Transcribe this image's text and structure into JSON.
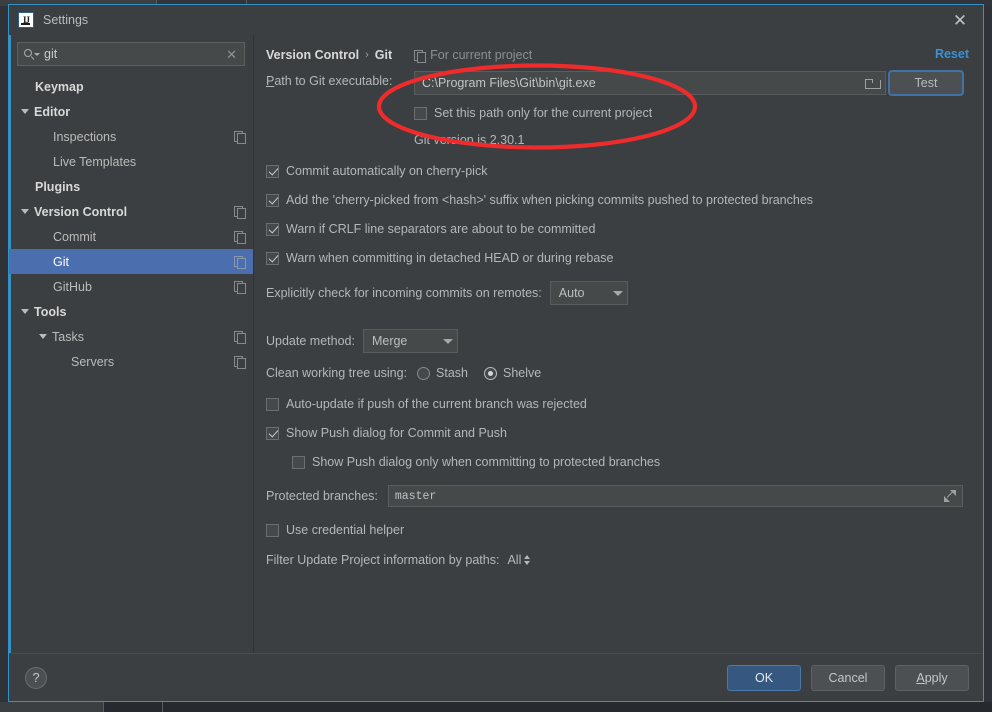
{
  "window": {
    "title": "Settings",
    "logo_icon": "intellij-idea-logo",
    "close_icon": "close-icon"
  },
  "sidebar": {
    "search": {
      "value": "git",
      "placeholder": "Search settings",
      "search_icon": "search-icon",
      "clear_icon": "close-icon"
    },
    "items": [
      {
        "label": "Keymap",
        "depth": 0,
        "arrow": false,
        "bold": true,
        "selected": false,
        "copy_icon": false
      },
      {
        "label": "Editor",
        "depth": 0,
        "arrow": true,
        "bold": true,
        "selected": false,
        "copy_icon": false
      },
      {
        "label": "Inspections",
        "depth": 1,
        "arrow": false,
        "bold": false,
        "selected": false,
        "copy_icon": true
      },
      {
        "label": "Live Templates",
        "depth": 1,
        "arrow": false,
        "bold": false,
        "selected": false,
        "copy_icon": false
      },
      {
        "label": "Plugins",
        "depth": 0,
        "arrow": false,
        "bold": true,
        "selected": false,
        "copy_icon": false
      },
      {
        "label": "Version Control",
        "depth": 0,
        "arrow": true,
        "bold": true,
        "selected": false,
        "copy_icon": true
      },
      {
        "label": "Commit",
        "depth": 1,
        "arrow": false,
        "bold": false,
        "selected": false,
        "copy_icon": true
      },
      {
        "label": "Git",
        "depth": 1,
        "arrow": false,
        "bold": false,
        "selected": true,
        "copy_icon": true
      },
      {
        "label": "GitHub",
        "depth": 1,
        "arrow": false,
        "bold": false,
        "selected": false,
        "copy_icon": true
      },
      {
        "label": "Tools",
        "depth": 0,
        "arrow": true,
        "bold": true,
        "selected": false,
        "copy_icon": false
      },
      {
        "label": "Tasks",
        "depth": 1,
        "arrow": true,
        "bold": false,
        "selected": false,
        "copy_icon": true
      },
      {
        "label": "Servers",
        "depth": 2,
        "arrow": false,
        "bold": false,
        "selected": false,
        "copy_icon": true
      }
    ]
  },
  "content": {
    "breadcrumb": {
      "parent": "Version Control",
      "separator": "›",
      "current": "Git",
      "scope_label": "For current project",
      "scope_icon": "project-scope-icon"
    },
    "reset_label": "Reset",
    "path": {
      "label": "Path to Git executable:",
      "label_mnemonic": "P",
      "label_rest": "ath to Git executable:",
      "value": "C:\\Program Files\\Git\\bin\\git.exe",
      "browse_icon": "folder-icon",
      "test_button": "Test"
    },
    "set_path_current_project": {
      "label": "Set this path only for the current project",
      "checked": false
    },
    "git_version": "Git version is 2.30.1",
    "checkboxes": [
      {
        "label": "Commit automatically on cherry-pick",
        "checked": true
      },
      {
        "label": "Add the 'cherry-picked from <hash>' suffix when picking commits pushed to protected branches",
        "checked": true
      },
      {
        "label": "Warn if CRLF line separators are about to be committed",
        "checked": true
      },
      {
        "label": "Warn when committing in detached HEAD or during rebase",
        "checked": true
      }
    ],
    "incoming": {
      "label": "Explicitly check for incoming commits on remotes:",
      "value": "Auto"
    },
    "update_method": {
      "label": "Update method:",
      "value": "Merge"
    },
    "clean_tree": {
      "label": "Clean working tree using:",
      "options": [
        {
          "label": "Stash",
          "selected": false
        },
        {
          "label": "Shelve",
          "selected": true
        }
      ]
    },
    "auto_update": {
      "label": "Auto-update if push of the current branch was rejected",
      "checked": false
    },
    "show_push": {
      "label": "Show Push dialog for Commit and Push",
      "checked": true
    },
    "show_push_protected": {
      "label": "Show Push dialog only when committing to protected branches",
      "checked": false
    },
    "protected_branches": {
      "label": "Protected branches:",
      "value": "master",
      "expand_icon": "expand-icon"
    },
    "use_credential_helper": {
      "label": "Use credential helper",
      "checked": false
    },
    "filter_paths": {
      "label": "Filter Update Project information by paths:",
      "value": "All"
    }
  },
  "footer": {
    "help_label": "?",
    "ok": "OK",
    "cancel": "Cancel",
    "apply_mnemonic": "A",
    "apply_rest": "pply"
  },
  "annotation": {
    "shape": "red-ellipse-highlight",
    "color": "#ef2b2b"
  },
  "colors": {
    "accent_selection": "#4b6eaf",
    "link": "#3d8fd1",
    "primary_button": "#365880",
    "panel": "#3c3f41",
    "field": "#45494a",
    "annotation": "#ef2b2b"
  }
}
